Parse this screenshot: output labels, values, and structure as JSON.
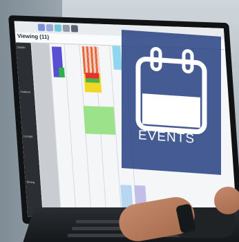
{
  "screen": {
    "title": "Viewing (11)",
    "rows": [
      "Studio",
      "Outdoor",
      "Lounge",
      "Dining"
    ]
  },
  "badge": {
    "label": "EVENTS"
  }
}
